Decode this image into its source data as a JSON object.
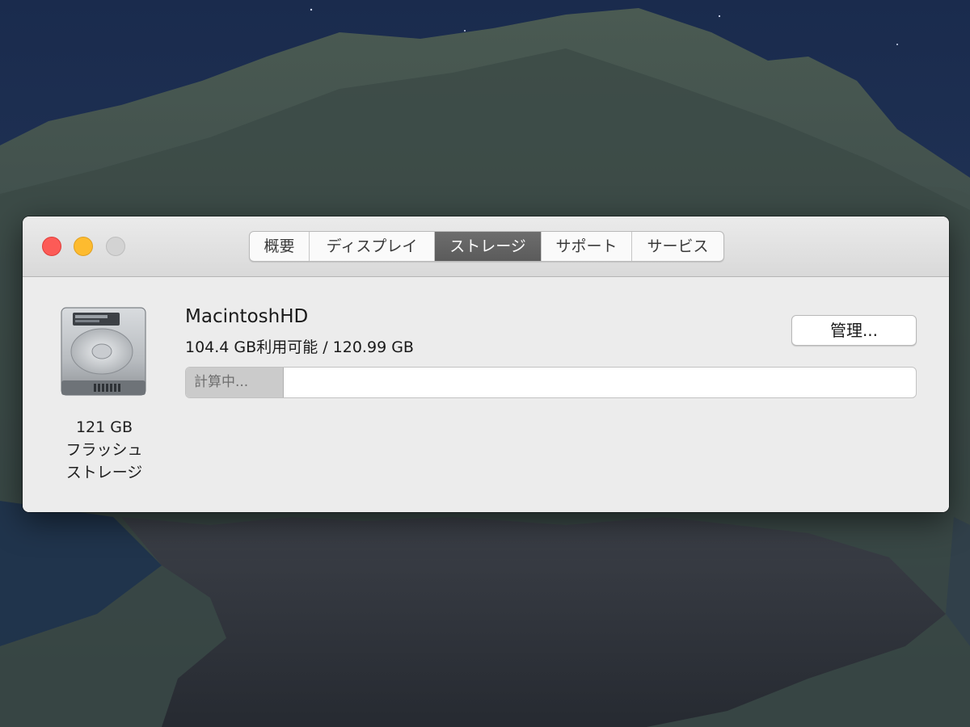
{
  "window": {
    "tabs": [
      {
        "label": "概要",
        "active": false
      },
      {
        "label": "ディスプレイ",
        "active": false
      },
      {
        "label": "ストレージ",
        "active": true
      },
      {
        "label": "サポート",
        "active": false
      },
      {
        "label": "サービス",
        "active": false
      }
    ]
  },
  "drive": {
    "capacity": "121 GB",
    "type_line1": "フラッシュ",
    "type_line2": "ストレージ",
    "icon": "hard-drive-icon"
  },
  "volume": {
    "name": "MacintoshHD",
    "space": "104.4 GB利用可能 / 120.99 GB",
    "manage_label": "管理...",
    "bar_label": "計算中...",
    "bar_fraction": 0.1337
  },
  "colors": {
    "close": "#fc5b57",
    "minimize": "#fdbb2f",
    "zoom_inactive": "#d3d3d3",
    "active_tab": "#5b5b5b",
    "window_bg": "#ececec",
    "bar_fill": "#cbcbcb"
  }
}
